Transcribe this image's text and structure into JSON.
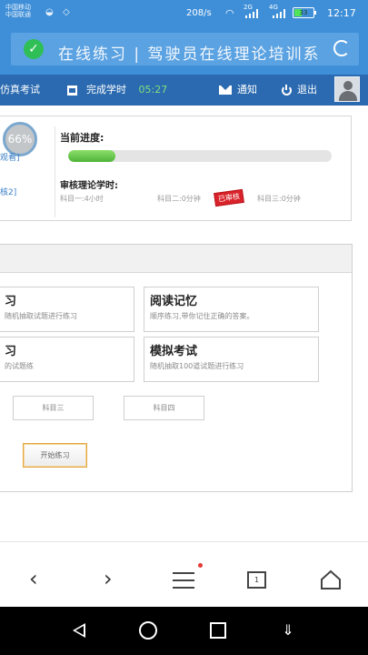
{
  "status_bar": {
    "carrier_1": "中国移动",
    "carrier_2": "中国联通",
    "net_speed": "208/s",
    "network_1": "2G",
    "network_2": "4G",
    "battery": "33",
    "time": "12:17"
  },
  "header": {
    "title": "在线练习 | 驾驶员在线理论培训系"
  },
  "toolbar": {
    "exam_label": "仿真考试",
    "completed_hours_label": "完成学时",
    "completed_hours_value": "05:27",
    "notify_label": "通知",
    "logout_label": "退出"
  },
  "progress_card": {
    "percent_text": "66%",
    "side_link_1": "观看]",
    "side_link_2": "核2]",
    "progress_label": "当前进度:",
    "progress_fraction": 0.18,
    "review_label": "审核理论学时:",
    "subject_1": "科目一:4小时",
    "subject_2": "科目二:0分钟",
    "stamp": "已审核",
    "subject_3": "科目三:0分钟"
  },
  "practice": {
    "tiles": [
      {
        "title": "习",
        "desc": "随机抽取试题进行练习"
      },
      {
        "title": "阅读记忆",
        "desc": "顺序练习,带你记住正确的答案。"
      },
      {
        "title": "习",
        "desc": "的试题练"
      },
      {
        "title": "模拟考试",
        "desc": "随机抽取100道试题进行练习"
      }
    ],
    "subject_buttons": [
      "科目三",
      "科目四"
    ],
    "start_button": "开始练习"
  },
  "browser": {
    "tab_count": "1"
  },
  "colors": {
    "header_blue": "#3f8fd8",
    "toolbar_blue": "#2b6ab0",
    "progress_green": "#5cc043",
    "stamp_red": "#d9232b",
    "accent_orange": "#e0a640"
  },
  "icons": [
    "check-icon",
    "refresh-icon",
    "calendar-icon",
    "mail-icon",
    "power-icon",
    "avatar-icon",
    "back-icon",
    "forward-icon",
    "menu-icon",
    "tabs-icon",
    "home-icon"
  ]
}
